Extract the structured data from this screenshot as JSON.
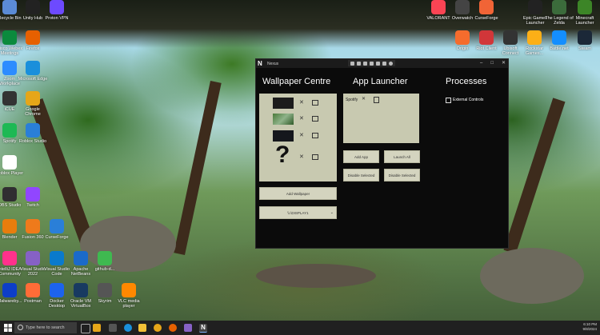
{
  "desktop": {
    "icons_left": [
      {
        "label": "Recycle Bin",
        "icon": "recycle-bin-icon",
        "color": "#5b8bd6"
      },
      {
        "label": "Unity Hub",
        "icon": "unity-hub-icon",
        "color": "#222222"
      },
      {
        "label": "Proton VPN",
        "icon": "proton-vpn-icon",
        "color": "#6d4aff"
      },
      {
        "label": "Cisco Webex Meetings",
        "icon": "webex-icon",
        "color": "#0b8a3d"
      },
      {
        "label": "Firefox",
        "icon": "firefox-icon",
        "color": "#e66000"
      },
      {
        "label": "Zoom Workplace",
        "icon": "zoom-icon",
        "color": "#2d8cff"
      },
      {
        "label": "Microsoft Edge",
        "icon": "edge-icon",
        "color": "#1a8fdb"
      },
      {
        "label": "iCUE",
        "icon": "icue-icon",
        "color": "#333333"
      },
      {
        "label": "Google Chrome",
        "icon": "chrome-icon",
        "color": "#e6a619"
      },
      {
        "label": "Spotify",
        "icon": "spotify-icon",
        "color": "#1db954"
      },
      {
        "label": "Roblox Studio",
        "icon": "roblox-studio-icon",
        "color": "#2a7fd8"
      },
      {
        "label": "Roblox Player",
        "icon": "roblox-player-icon",
        "color": "#ffffff"
      },
      {
        "label": "OBS Studio",
        "icon": "obs-icon",
        "color": "#302e31"
      },
      {
        "label": "Twitch",
        "icon": "twitch-icon",
        "color": "#9146ff"
      },
      {
        "label": "Blender",
        "icon": "blender-icon",
        "color": "#e87d0d"
      },
      {
        "label": "Fusion 360",
        "icon": "fusion-icon",
        "color": "#ef7a1b"
      },
      {
        "label": "CurseForge",
        "icon": "curseforge-icon",
        "color": "#2a7fd8"
      },
      {
        "label": "IntelliJ IDEA Community",
        "icon": "intellij-icon",
        "color": "#ff318c"
      },
      {
        "label": "Visual Studio 2022",
        "icon": "visual-studio-icon",
        "color": "#8661c5"
      },
      {
        "label": "Visual Studio Code",
        "icon": "vscode-icon",
        "color": "#0a7acc"
      },
      {
        "label": "Apache NetBeans",
        "icon": "netbeans-icon",
        "color": "#1b6ac9"
      },
      {
        "label": "github-d...",
        "icon": "github-icon",
        "color": "#3fb950"
      },
      {
        "label": "Malwareby...",
        "icon": "malwarebytes-icon",
        "color": "#0d3ec7"
      },
      {
        "label": "Postman",
        "icon": "postman-icon",
        "color": "#ff6c37"
      },
      {
        "label": "Docker Desktop",
        "icon": "docker-icon",
        "color": "#1d63ed"
      },
      {
        "label": "Oracle VM VirtualBox",
        "icon": "virtualbox-icon",
        "color": "#183a61"
      },
      {
        "label": "Skyrim",
        "icon": "skyrim-icon",
        "color": "#555555"
      },
      {
        "label": "VLC media player",
        "icon": "vlc-icon",
        "color": "#ff8800"
      }
    ],
    "icons_right": [
      {
        "label": "VALORANT",
        "icon": "valorant-icon",
        "color": "#fa4454"
      },
      {
        "label": "Overwatch",
        "icon": "overwatch-icon",
        "color": "#444444"
      },
      {
        "label": "CurseForge",
        "icon": "curseforge-icon",
        "color": "#f16436"
      },
      {
        "label": "Epic Games Launcher",
        "icon": "epic-games-icon",
        "color": "#222222"
      },
      {
        "label": "The Legend of Zelda",
        "icon": "zelda-icon",
        "color": "#3b6b3b"
      },
      {
        "label": "Minecraft Launcher",
        "icon": "minecraft-icon",
        "color": "#3c8527"
      },
      {
        "label": "Origin",
        "icon": "origin-icon",
        "color": "#f56c2d"
      },
      {
        "label": "Riot Client",
        "icon": "riot-icon",
        "color": "#d13639"
      },
      {
        "label": "Ubisoft Connect",
        "icon": "ubisoft-icon",
        "color": "#333333"
      },
      {
        "label": "Rockstar Games...",
        "icon": "rockstar-icon",
        "color": "#fcaf17"
      },
      {
        "label": "Battle.net",
        "icon": "battlenet-icon",
        "color": "#148eff"
      },
      {
        "label": "Steam",
        "icon": "steam-icon",
        "color": "#1b2838"
      }
    ]
  },
  "window": {
    "title": "Nexus",
    "logo": "N",
    "controls": {
      "minimize": "–",
      "maximize": "□",
      "close": "✕"
    },
    "sections": {
      "wallpaper": "Wallpaper Centre",
      "launcher": "App Launcher",
      "processes": "Processes"
    },
    "wallpaper": {
      "unknown_mark": "?",
      "remove_glyph": "✕",
      "add_button": "Add Wallpaper",
      "display_select": "\\\\.\\DISPLAY1",
      "display_chevron": "⌄"
    },
    "launcher": {
      "apps": [
        {
          "name": "Spotify",
          "remove_glyph": "✕"
        }
      ],
      "add_app": "Add App",
      "launch_all": "Launch All",
      "disable_selected_1": "Disable Selected",
      "disable_selected_2": "Disable Selected"
    },
    "processes": {
      "external_controls": "External Controls"
    }
  },
  "taskbar": {
    "search_placeholder": "Type here to search",
    "time": "6:10 PM",
    "date": "9/8/2024"
  }
}
